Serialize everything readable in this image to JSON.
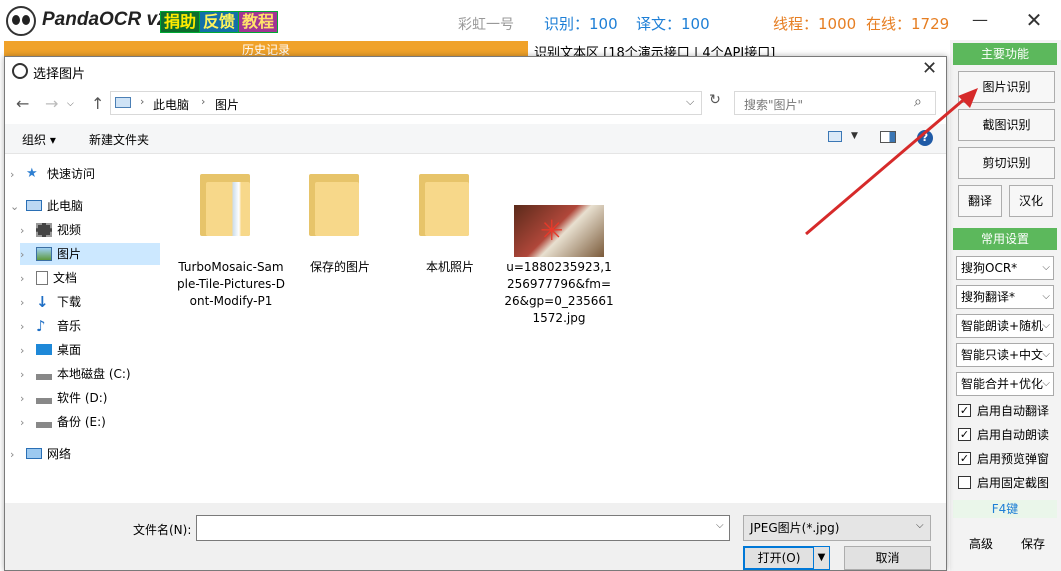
{
  "app": {
    "name": "PandaOCR v2.6",
    "badges": {
      "donate": "捐助",
      "feedback": "反馈",
      "tutorial": "教程"
    },
    "rainbow": "彩虹一号",
    "ocr_count": "识别：100",
    "trans_count": "译文：100",
    "threads": "线程：1000",
    "online": "在线：1729",
    "minimize": "—",
    "close": "✕",
    "history_tab": "历史记录",
    "textarea_label": "识别文本区 [18个演示接口 | 4个API接口]"
  },
  "right_panel": {
    "main_features": "主要功能",
    "btn_image_ocr": "图片识别",
    "btn_screenshot_ocr": "截图识别",
    "btn_clip_ocr": "剪切识别",
    "btn_translate": "翻译",
    "btn_chinese": "汉化",
    "common_settings": "常用设置",
    "selects": [
      "搜狗OCR*",
      "搜狗翻译*",
      "智能朗读+随机",
      "智能只读+中文",
      "智能合并+优化"
    ],
    "checks": [
      {
        "label": "启用自动翻译",
        "checked": true
      },
      {
        "label": "启用自动朗读",
        "checked": true
      },
      {
        "label": "启用预览弹窗",
        "checked": true
      },
      {
        "label": "启用固定截图",
        "checked": false
      }
    ],
    "f4_key": "F4键",
    "btn_advanced": "高级",
    "btn_save": "保存"
  },
  "dialog": {
    "title": "选择图片",
    "address": {
      "pc": "此电脑",
      "pictures": "图片"
    },
    "search_placeholder": "搜索\"图片\"",
    "toolbar": {
      "organize": "组织 ▾",
      "new_folder": "新建文件夹"
    },
    "nav": [
      {
        "label": "快速访问",
        "icon": "star-icon"
      },
      {
        "label": "此电脑",
        "icon": "computer-icon"
      },
      {
        "label": "视频",
        "icon": "video-icon"
      },
      {
        "label": "图片",
        "icon": "pictures-icon"
      },
      {
        "label": "文档",
        "icon": "document-icon"
      },
      {
        "label": "下载",
        "icon": "download-icon"
      },
      {
        "label": "音乐",
        "icon": "music-icon"
      },
      {
        "label": "桌面",
        "icon": "desktop-icon"
      },
      {
        "label": "本地磁盘 (C:)",
        "icon": "drive-icon"
      },
      {
        "label": "软件 (D:)",
        "icon": "drive-icon"
      },
      {
        "label": "备份 (E:)",
        "icon": "drive-icon"
      },
      {
        "label": "网络",
        "icon": "network-icon"
      }
    ],
    "files": [
      {
        "name": "TurboMosaic-Sample-Tile-Pictures-Dont-Modify-P1",
        "type": "folder"
      },
      {
        "name": "保存的图片",
        "type": "folder"
      },
      {
        "name": "本机照片",
        "type": "folder"
      },
      {
        "name": "u=1880235923,1256977796&fm=26&gp=0_2356611572.jpg",
        "type": "image"
      }
    ],
    "filename_label": "文件名(N):",
    "filename_value": "",
    "filter": "JPEG图片(*.jpg)",
    "open": "打开(O)",
    "cancel": "取消"
  }
}
